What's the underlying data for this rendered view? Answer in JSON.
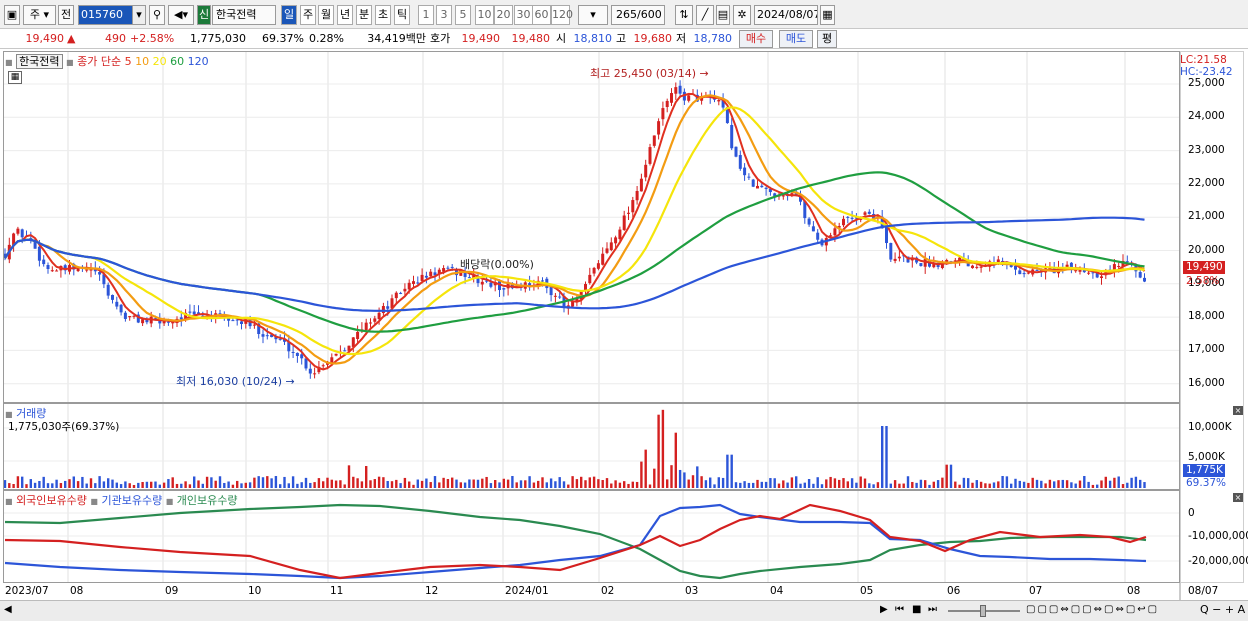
{
  "toolbar": {
    "mode": "주",
    "prev_label": "전",
    "code": "015760",
    "badge": "신",
    "stock_name": "한국전력",
    "periods": [
      "일",
      "주",
      "월",
      "년",
      "분",
      "초",
      "틱"
    ],
    "active_period": "일",
    "minutes": [
      "1",
      "3",
      "5",
      "10",
      "20",
      "30",
      "60",
      "120"
    ],
    "count": "265",
    "count_total": "/600",
    "date": "2024/08/07"
  },
  "info": {
    "price": "19,490",
    "change": "490",
    "change_pct": "+2.58%",
    "volume": "1,775,030",
    "vol_ratio": "69.37%",
    "turnover": "0.28%",
    "amount": "34,419백만",
    "bid_label": "호가",
    "bid1": "19,490",
    "bid2": "19,480",
    "open_label": "시",
    "open": "18,810",
    "high_label": "고",
    "high": "19,680",
    "low_label": "저",
    "low": "18,780",
    "buy_btn": "매수",
    "sell_btn": "매도",
    "eval_btn": "평"
  },
  "price_panel": {
    "title": "한국전력",
    "ma_label": "종가 단순",
    "ma_periods": [
      "5",
      "10",
      "20",
      "60",
      "120"
    ],
    "ma_colors": [
      "#e03020",
      "#f39c12",
      "#f5e50b",
      "#1f9e40",
      "#2c55d8"
    ],
    "max_label": "최고 25,450 (03/14)",
    "min_label": "최저 16,030 (10/24)",
    "dividend_label": "배당락(0.00%)",
    "lc": "LC:21.58",
    "hc": "HC:-23.42",
    "y_ticks": [
      "25,000",
      "24,000",
      "23,000",
      "22,000",
      "21,000",
      "20,000",
      "19,000",
      "18,000",
      "17,000",
      "16,000"
    ],
    "current_price_tag": "19,490",
    "current_pct_tag": "2.58%"
  },
  "volume_panel": {
    "title": "거래량",
    "value_label": "1,775,030주(69.37%)",
    "y_ticks": [
      "10,000K",
      "5,000K"
    ],
    "tag": "1,775K",
    "tag_pct": "69.37%"
  },
  "investor_panel": {
    "legend": [
      "외국인보유수량",
      "기관보유수량",
      "개인보유수량"
    ],
    "legend_colors": [
      "#d42020",
      "#2c55d8",
      "#2a8a50"
    ],
    "y_ticks": [
      "0",
      "-10,000,000",
      "-20,000,000"
    ]
  },
  "x_axis": {
    "labels": [
      "2023/07",
      "08",
      "09",
      "10",
      "11",
      "12",
      "2024/01",
      "02",
      "03",
      "04",
      "05",
      "06",
      "07",
      "08"
    ],
    "right_label": "08/07"
  },
  "colors": {
    "up": "#d42020",
    "down": "#2c55d8",
    "accent": "#0b4fa8"
  }
}
